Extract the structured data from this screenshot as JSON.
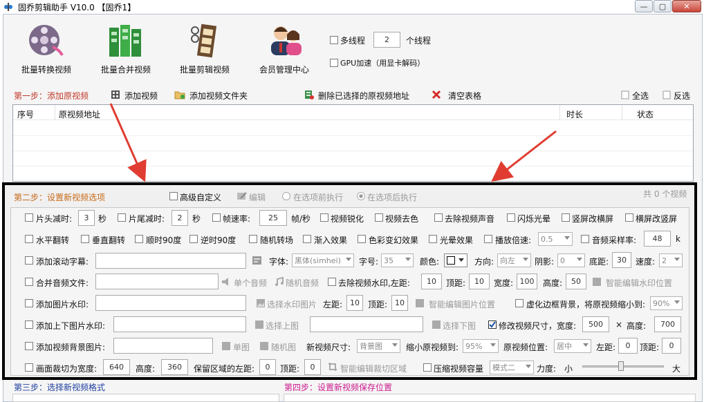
{
  "window": {
    "title": "固乔剪辑助手 V10.0  【固乔1】"
  },
  "toolbar": {
    "batch_convert": "批量转换视频",
    "batch_merge": "批量合并视频",
    "batch_cut": "批量剪辑视频",
    "member": "会员管理中心",
    "multithread": "多线程",
    "threads": "2",
    "threads_unit": "个线程",
    "gpu": "GPU加速（用显卡解码）"
  },
  "step1": {
    "label": "第一步：添加原视频",
    "add_video": "添加视频",
    "add_folder": "添加视频文件夹",
    "delete_selected": "删除已选择的原视频地址",
    "clear_table": "清空表格",
    "select_all": "全选",
    "invert": "反选",
    "columns": [
      "序号",
      "原视频地址",
      "时长",
      "状态"
    ]
  },
  "step2": {
    "label": "第二步：设置新视频选项",
    "advanced": "高级自定义",
    "edit": "编辑",
    "before": "在选项前执行",
    "after": "在选项后执行",
    "count": "共 0 个视频",
    "row1": {
      "head_cut": "片头减时:",
      "head_val": "3",
      "sec1": "秒",
      "tail_cut": "片尾减时:",
      "tail_val": "2",
      "sec2": "秒",
      "fps": "帧速率:",
      "fps_val": "25",
      "fps_unit": "帧/秒",
      "sharpen": "视频锐化",
      "decolor": "视频去色",
      "mute": "去除视频声音",
      "flash": "闪烁光晕",
      "v2h": "竖屏改横屏",
      "h2v": "横屏改竖屏"
    },
    "row2": {
      "hflip": "水平翻转",
      "vflip": "垂直翻转",
      "rot90": "顺时90度",
      "rotm90": "逆时90度",
      "random": "随机转场",
      "fadein": "渐入效果",
      "color": "色彩变幻效果",
      "halo": "光晕效果",
      "speed": "播放倍速:",
      "speed_val": "0.5",
      "sample": "音频采样率:",
      "sample_val": "48",
      "sample_unit": "k"
    },
    "row3": {
      "subtitle": "添加滚动字幕:",
      "font": "字体:",
      "font_val": "黑体(simhei)",
      "size": "字号:",
      "size_val": "35",
      "color": "颜色:",
      "dir": "方向:",
      "dir_val": "向左",
      "shadow": "阴影:",
      "shadow_val": "0",
      "bottom": "底距:",
      "bottom_val": "30",
      "speed": "速度:",
      "speed_val": "2"
    },
    "row4": {
      "merge_audio": "合并音频文件:",
      "single_audio": "单个音频",
      "random_audio": "随机音频",
      "remove_wm": "去除视频水印,左距:",
      "left_val": "10",
      "top": "顶距:",
      "top_val": "10",
      "width": "宽度:",
      "width_val": "100",
      "height": "高度:",
      "height_val": "50",
      "smart_wm": "智能编辑水印位置"
    },
    "row5": {
      "img_wm": "添加图片水印:",
      "choose_img": "选择水印图片",
      "left": "左距:",
      "left_val": "10",
      "top": "顶距:",
      "top_val": "10",
      "smart_img": "智能编辑图片位置",
      "blur": "虚化边框背景，将原视频缩小到:",
      "blur_val": "90%"
    },
    "row6": {
      "updown": "添加上下图片水印:",
      "choose_up": "选择上图",
      "choose_down": "选择下图",
      "resize": "修改视频尺寸，宽度:",
      "w_val": "500",
      "times": "×",
      "h_label": "高度:",
      "h_val": "700"
    },
    "row7": {
      "bgimg": "添加视频背景图片:",
      "single": "单图",
      "random": "随机图",
      "newsize": "新视频尺寸:",
      "newsize_val": "背景图",
      "shrink": "缩小原视频到:",
      "shrink_val": "95%",
      "pos": "原视频位置:",
      "pos_val": "居中",
      "left": "左距:",
      "left_val": "0",
      "top": "顶距:",
      "top_val": "0"
    },
    "row8": {
      "crop": "画面裁切为宽度:",
      "crop_w": "640",
      "h": "高度:",
      "crop_h": "360",
      "keep_left": "保留区域的左距:",
      "keep_left_val": "0",
      "top": "顶距:",
      "top_val": "0",
      "smart_crop": "智能编辑裁切区域",
      "compress": "压缩视频容量",
      "mode_val": "模式二",
      "strength": "力度:",
      "small": "小",
      "big": "大"
    }
  },
  "step3": {
    "label": "第三步：选择新视频格式"
  },
  "step4": {
    "label": "第四步：设置新视频保存位置"
  },
  "colors": {
    "step_red": "#c0392b",
    "step_blue": "#1f3fa0",
    "step_magenta": "#cc1a8e",
    "arrow": "#e03c31",
    "frame": "#000000"
  }
}
